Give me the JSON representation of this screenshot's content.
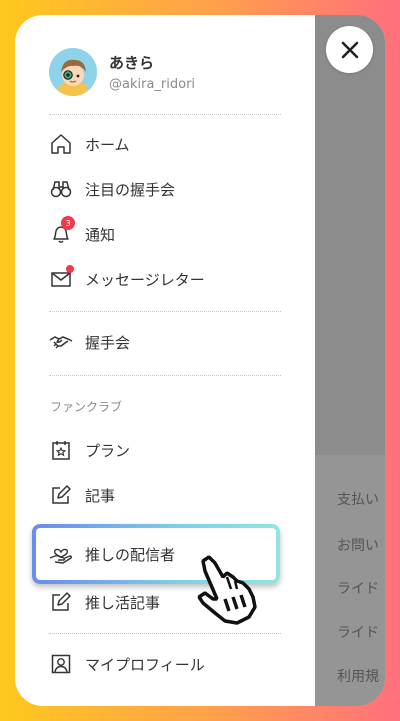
{
  "profile": {
    "name": "あきら",
    "handle": "@akira_ridori"
  },
  "menu": {
    "home": "ホーム",
    "featured": "注目の握手会",
    "notifications": "通知",
    "notification_count": "3",
    "messages": "メッセージレター",
    "handshake": "握手会",
    "fanclub_section": "ファンクラブ",
    "plans": "プラン",
    "articles": "記事",
    "oshi_streamers": "推しの配信者",
    "oshi_articles": "推し活記事",
    "my_profile": "マイプロフィール"
  },
  "background_menu": [
    "支払い",
    "お問い",
    "ライド",
    "ライド",
    "利用規"
  ],
  "icons": {
    "close": "close-icon",
    "home": "home-icon",
    "binoculars": "binoculars-icon",
    "bell": "bell-icon",
    "mail": "mail-icon",
    "handshake": "handshake-icon",
    "calendar_star": "calendar-star-icon",
    "edit": "edit-icon",
    "heart_hand": "heart-hand-icon",
    "profile": "profile-icon",
    "pointer": "hand-pointer-icon"
  },
  "colors": {
    "frame_gradient": [
      "#ffc81e",
      "#ff9f4d",
      "#ff6f7d"
    ],
    "badge": "#f0394a",
    "highlight_gradient": [
      "#6a8bf0",
      "#7ed0e6",
      "#8ee8e0"
    ]
  }
}
